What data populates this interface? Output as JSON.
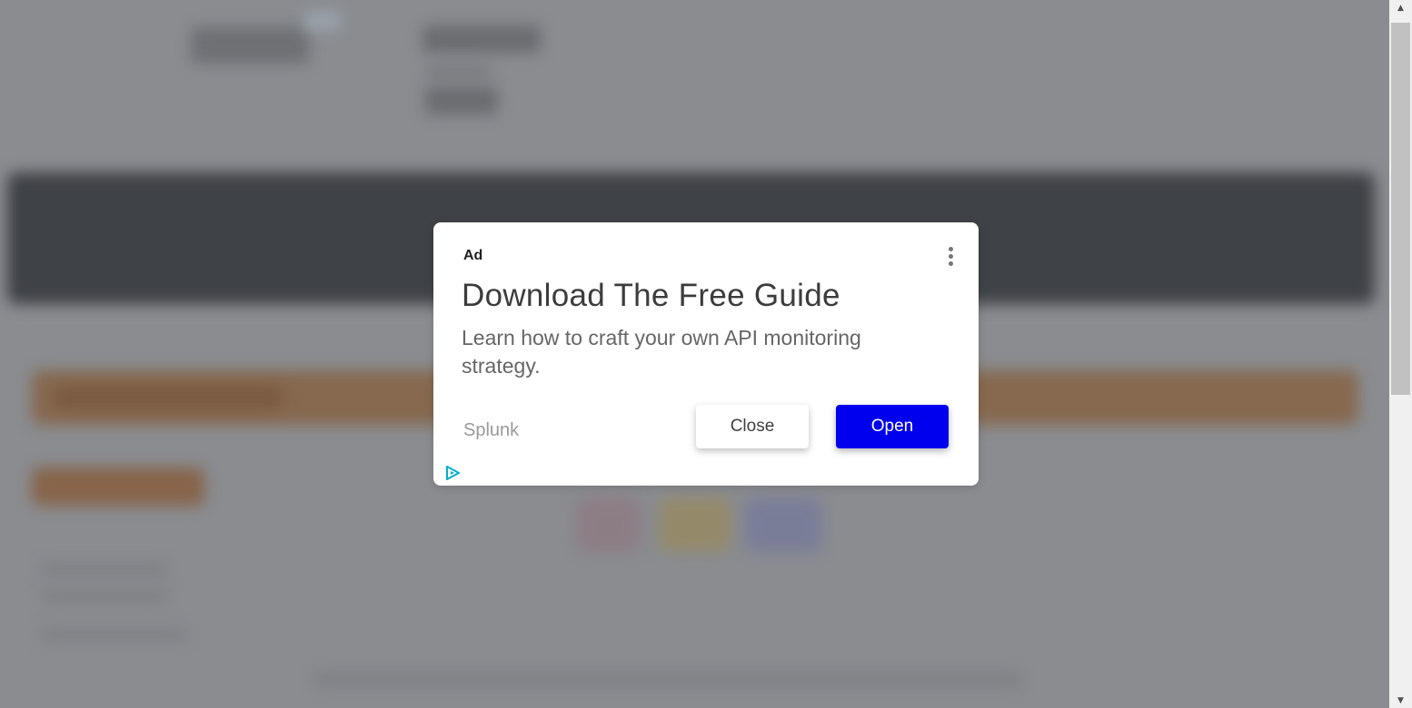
{
  "ad": {
    "label": "Ad",
    "title": "Download The Free Guide",
    "description": "Learn how to craft your own API monitoring strategy.",
    "advertiser": "Splunk",
    "close_label": "Close",
    "open_label": "Open",
    "open_button_color": "#0000ee",
    "menu_icon": "more-vert-icon",
    "adchoices_icon": "adchoices-icon"
  },
  "colors": {
    "overlay": "#8a8c90",
    "card": "#ffffff",
    "adchoices": "#00aecd"
  }
}
